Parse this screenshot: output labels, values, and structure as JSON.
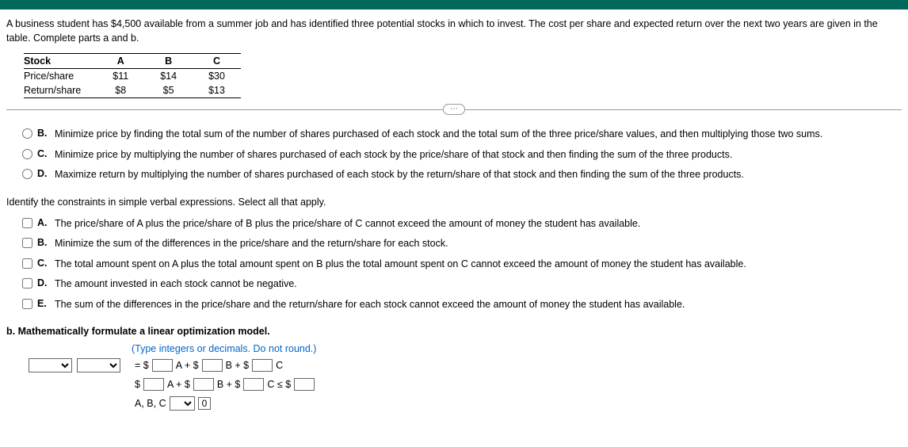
{
  "problem": "A business student has $4,500 available from a summer job and has identified three potential stocks in which to invest. The cost per share and expected return over the next two years are given in the table. Complete parts a and b.",
  "table": {
    "h0": "Stock",
    "h1": "A",
    "h2": "B",
    "h3": "C",
    "r1c0": "Price/share",
    "r1c1": "$11",
    "r1c2": "$14",
    "r1c3": "$30",
    "r2c0": "Return/share",
    "r2c1": "$8",
    "r2c2": "$5",
    "r2c3": "$13"
  },
  "divider_label": "⋯",
  "radio": {
    "b": "Minimize price by finding the total sum of the number of shares purchased of each stock and the total sum of the three price/share values, and then multiplying those two sums.",
    "c": "Minimize price by multiplying the number of shares purchased of each stock by the price/share of that stock and then finding the sum of the three products.",
    "d": "Maximize return by multiplying the number of shares purchased of each stock by the return/share of that stock and then finding the sum of the three products."
  },
  "constraint_q": "Identify the constraints in simple verbal expressions. Select all that apply.",
  "check": {
    "a": "The price/share of A plus the price/share of B plus the price/share of C cannot exceed the amount of money the student has available.",
    "b": "Minimize the sum of the differences in the price/share and the return/share for each stock.",
    "c": "The total amount spent on A plus the total amount spent on B plus the total amount spent on C cannot exceed the amount of money the student has available.",
    "d": "The amount invested in each stock cannot be negative.",
    "e": "The sum of the differences in the price/share and the return/share for each stock cannot exceed the amount of money the student has available."
  },
  "part_b": "b. Mathematically formulate a linear optimization model.",
  "hint": "(Type integers or decimals. Do not round.)",
  "eq1": {
    "pre": "= $",
    "mid1": "A + $",
    "mid2": "B + $",
    "end": "C"
  },
  "eq2": {
    "pre": "$",
    "mid1": "A + $",
    "mid2": "B + $",
    "mid3": "C ≤ $"
  },
  "eq3": {
    "lbl": "A, B, C",
    "zero": "0"
  },
  "letters": {
    "b": "B.",
    "c": "C.",
    "d": "D.",
    "a": "A.",
    "e": "E."
  },
  "colors": {
    "accent": "#0066cc",
    "header": "#00695c"
  }
}
